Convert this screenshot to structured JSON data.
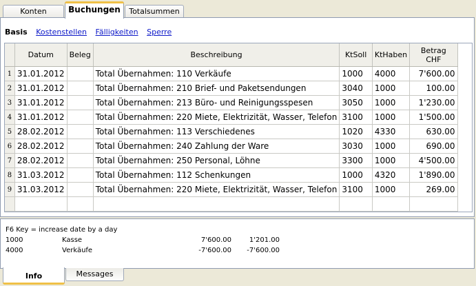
{
  "tabs_top": [
    {
      "label": "Konten",
      "active": false
    },
    {
      "label": "Buchungen",
      "active": true
    },
    {
      "label": "Totalsummen",
      "active": false
    }
  ],
  "subtabs": [
    {
      "label": "Basis",
      "active": true
    },
    {
      "label": "Kostenstellen",
      "active": false
    },
    {
      "label": "Fälligkeiten",
      "active": false
    },
    {
      "label": "Sperre",
      "active": false
    }
  ],
  "columns": {
    "date": "Datum",
    "doc": "Beleg",
    "desc": "Beschreibung",
    "debit": "KtSoll",
    "credit": "KtHaben",
    "amount_line1": "Betrag",
    "amount_line2": "CHF"
  },
  "rows": [
    {
      "n": "1",
      "date": "31.01.2012",
      "doc": "",
      "desc": "Total Übernahmen: 110 Verkäufe",
      "debit": "1000",
      "credit": "4000",
      "amount": "7'600.00"
    },
    {
      "n": "2",
      "date": "31.01.2012",
      "doc": "",
      "desc": "Total Übernahmen: 210 Brief- und Paketsendungen",
      "debit": "3040",
      "credit": "1000",
      "amount": "100.00"
    },
    {
      "n": "3",
      "date": "31.01.2012",
      "doc": "",
      "desc": "Total Übernahmen: 213 Büro- und Reinigungsspesen",
      "debit": "3050",
      "credit": "1000",
      "amount": "1'230.00"
    },
    {
      "n": "4",
      "date": "31.01.2012",
      "doc": "",
      "desc": "Total Übernahmen: 220 Miete, Elektrizität, Wasser, Telefon",
      "debit": "3100",
      "credit": "1000",
      "amount": "1'500.00"
    },
    {
      "n": "5",
      "date": "28.02.2012",
      "doc": "",
      "desc": "Total Übernahmen: 113 Verschiedenes",
      "debit": "1020",
      "credit": "4330",
      "amount": "630.00"
    },
    {
      "n": "6",
      "date": "28.02.2012",
      "doc": "",
      "desc": "Total Übernahmen: 240 Zahlung der Ware",
      "debit": "3030",
      "credit": "1000",
      "amount": "690.00"
    },
    {
      "n": "7",
      "date": "28.02.2012",
      "doc": "",
      "desc": "Total Übernahmen: 250 Personal, Löhne",
      "debit": "3300",
      "credit": "1000",
      "amount": "4'500.00"
    },
    {
      "n": "8",
      "date": "31.03.2012",
      "doc": "",
      "desc": "Total Übernahmen: 112 Schenkungen",
      "debit": "1000",
      "credit": "4320",
      "amount": "1'890.00"
    },
    {
      "n": "9",
      "date": "31.03.2012",
      "doc": "",
      "desc": "Total Übernahmen: 220 Miete, Elektrizität, Wasser, Telefon",
      "debit": "3100",
      "credit": "1000",
      "amount": "269.00"
    }
  ],
  "info": {
    "title": "F6 Key = increase date by a day",
    "rows": [
      {
        "account": "1000",
        "name": "Kasse",
        "v1": "7'600.00",
        "v2": "1'201.00"
      },
      {
        "account": "4000",
        "name": "Verkäufe",
        "v1": "-7'600.00",
        "v2": "-7'600.00"
      }
    ]
  },
  "tabs_bottom": [
    {
      "label": "Info",
      "active": true
    },
    {
      "label": "Messages",
      "active": false
    }
  ],
  "colors": {
    "active_tab_accent": "#f0c046",
    "link": "#0b17c8",
    "background": "#ece9d8"
  }
}
